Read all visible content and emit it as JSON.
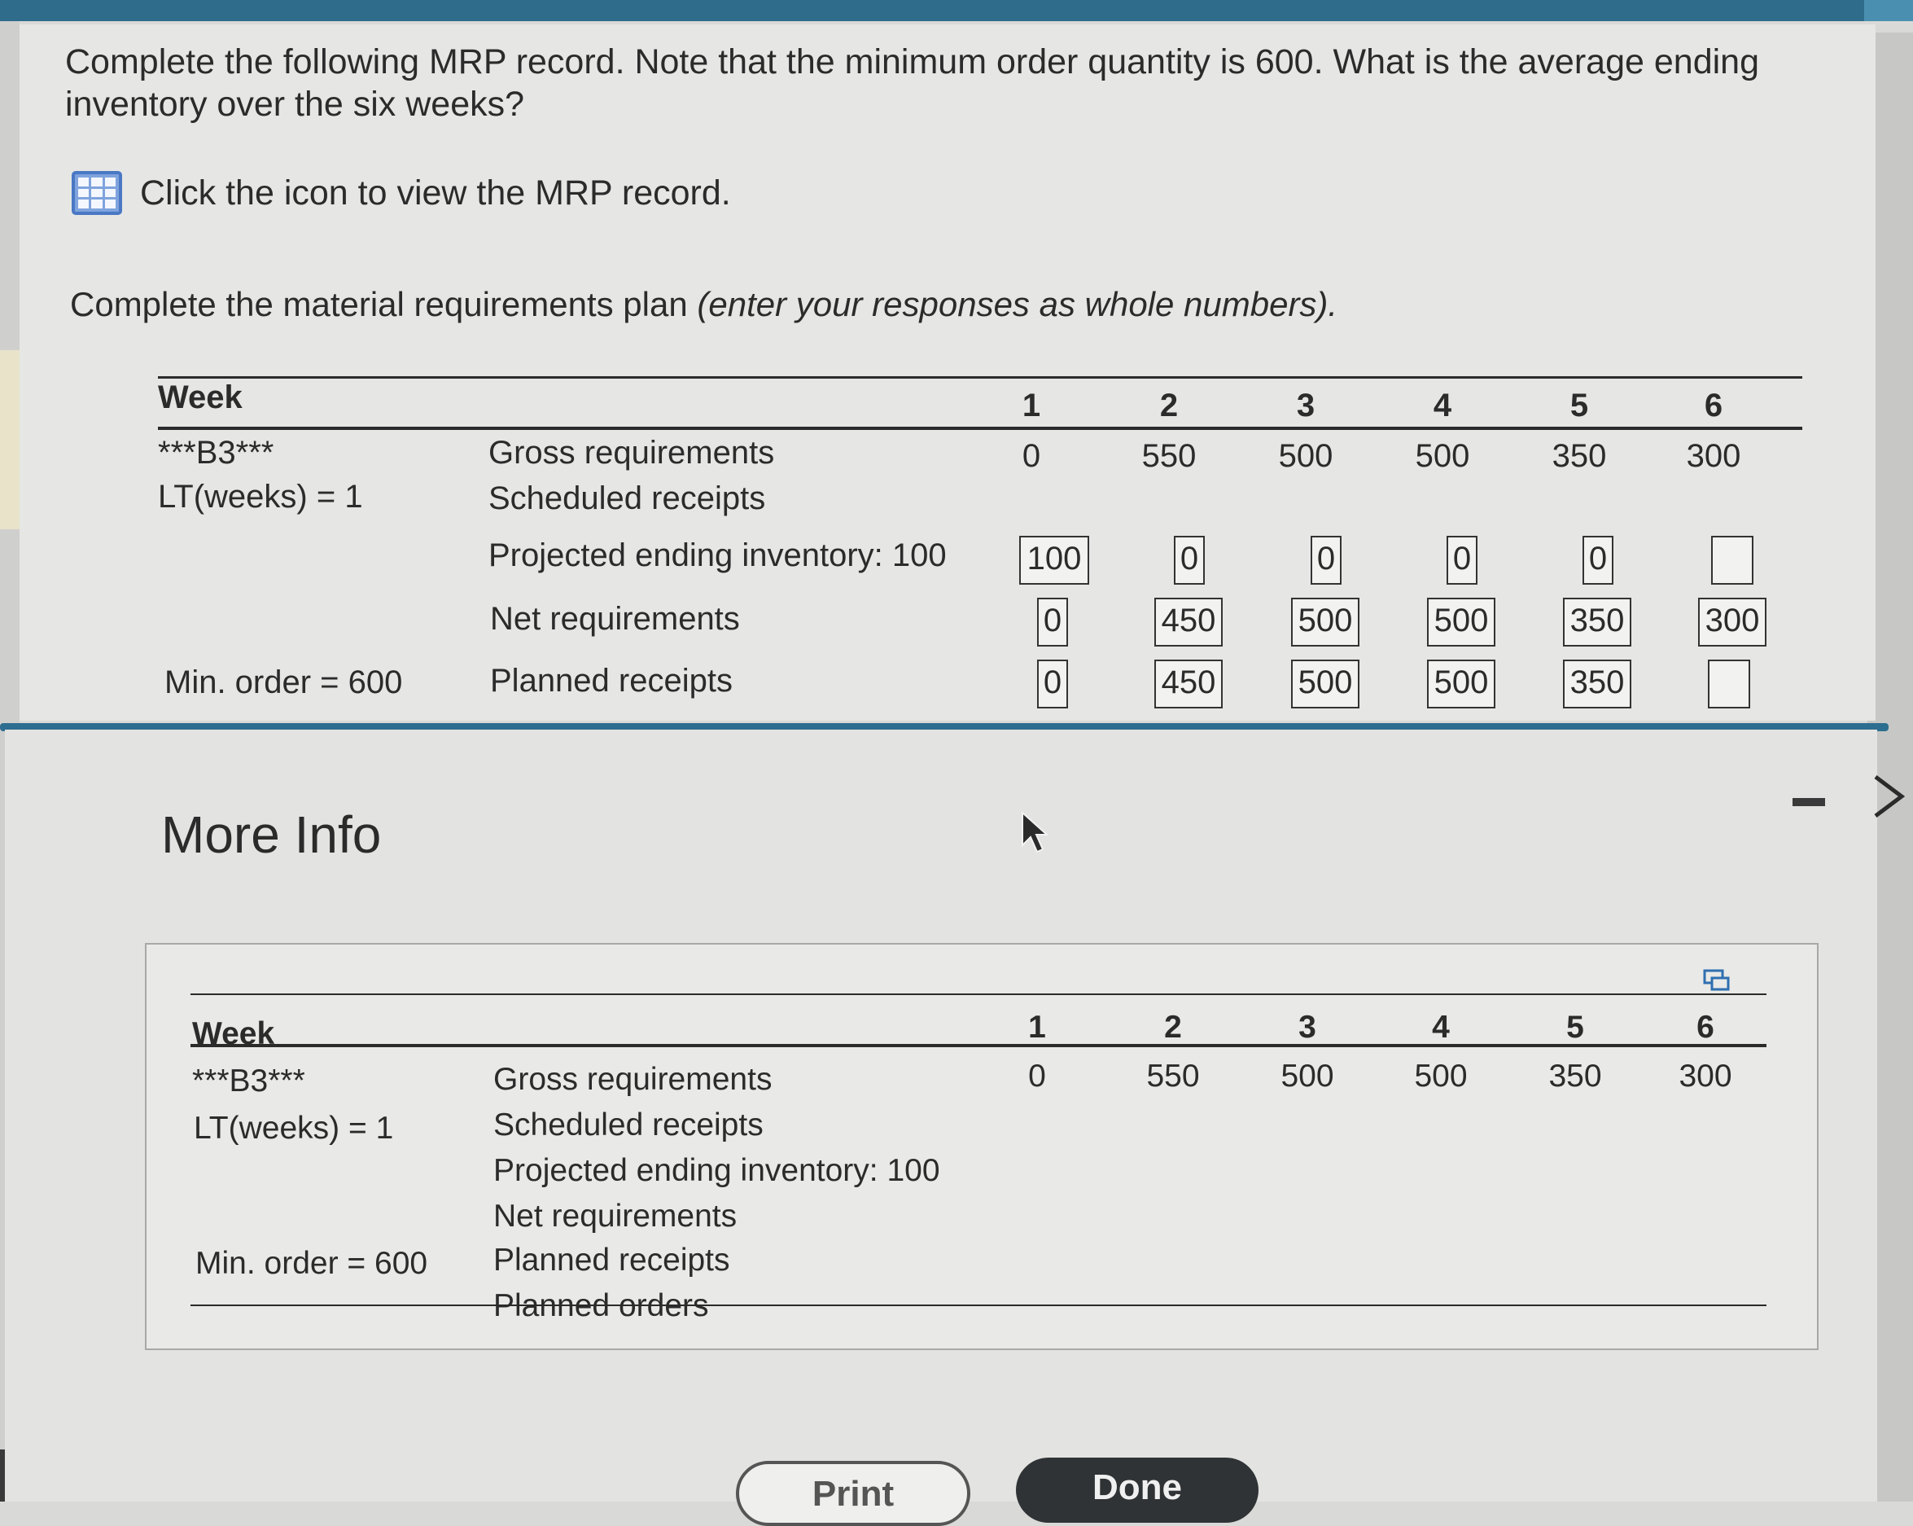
{
  "question": {
    "text": "Complete the following MRP record. Note that the minimum order quantity is 600. What is the average ending inventory over the six weeks?",
    "icon_label": "Click the icon to view the MRP record.",
    "instructions_prefix": "Complete the material requirements plan ",
    "instructions_italic": "(enter your responses as whole numbers)."
  },
  "mrp": {
    "week_label": "Week",
    "item": "***B3***",
    "lead_time": "LT(weeks) = 1",
    "min_order": "Min. order = 600",
    "weeks": [
      "1",
      "2",
      "3",
      "4",
      "5",
      "6"
    ],
    "rows": {
      "gross": "Gross requirements",
      "scheduled": "Scheduled receipts",
      "projected": "Projected ending inventory: 100",
      "net": "Net requirements",
      "planned_receipts": "Planned receipts",
      "planned_orders": "Planned orders"
    },
    "gross_values": [
      "0",
      "550",
      "500",
      "500",
      "350",
      "300"
    ],
    "inputs": {
      "projected": [
        "100",
        "0",
        "0",
        "0",
        "0",
        ""
      ],
      "net": [
        "0",
        "450",
        "500",
        "500",
        "350",
        "300"
      ],
      "planned_receipts": [
        "0",
        "450",
        "500",
        "500",
        "350",
        ""
      ]
    }
  },
  "modal": {
    "title": "More Info",
    "print_label": "Print",
    "done_label": "Done"
  },
  "icons": [
    "grid-table-icon",
    "minimize-icon",
    "close-icon",
    "popout-icon",
    "mouse-cursor-icon"
  ]
}
